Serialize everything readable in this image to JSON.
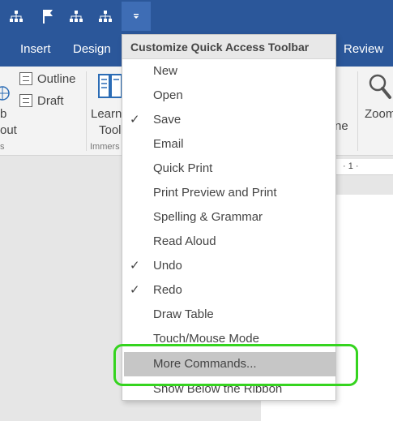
{
  "qat": {
    "icons": [
      "org-chart-icon",
      "flag-icon",
      "org-chart-icon",
      "org-chart-icon"
    ],
    "dropdown_icon": "customize-dropdown-icon"
  },
  "tabs": [
    {
      "label": "Insert"
    },
    {
      "label": "Design"
    },
    {
      "label": "Review"
    }
  ],
  "ribbon": {
    "outline_label": "Outline",
    "draft_label": "Draft",
    "web_layout_part1": "b",
    "web_layout_part2": "out",
    "learning_tools_part1": "Learni",
    "learning_tools_part2": "Tool",
    "immersive_group": "Immers",
    "left_group_fragment": "s",
    "one_page_fragment": "ne",
    "zoom_label": "Zoom",
    "ruler_text": "· 1 ·"
  },
  "menu": {
    "title": "Customize Quick Access Toolbar",
    "items": [
      {
        "label": "New",
        "checked": false
      },
      {
        "label": "Open",
        "checked": false
      },
      {
        "label": "Save",
        "checked": true
      },
      {
        "label": "Email",
        "checked": false
      },
      {
        "label": "Quick Print",
        "checked": false
      },
      {
        "label": "Print Preview and Print",
        "checked": false
      },
      {
        "label": "Spelling & Grammar",
        "checked": false
      },
      {
        "label": "Read Aloud",
        "checked": false
      },
      {
        "label": "Undo",
        "checked": true
      },
      {
        "label": "Redo",
        "checked": true
      },
      {
        "label": "Draw Table",
        "checked": false
      },
      {
        "label": "Touch/Mouse Mode",
        "checked": false
      }
    ],
    "more_commands": "More Commands...",
    "show_below_ribbon": "Show Below the Ribbon",
    "check_glyph": "✓"
  },
  "colors": {
    "title_bar": "#2b579a",
    "highlight": "#c6c6c6",
    "annotation_ring": "#35d41f"
  }
}
